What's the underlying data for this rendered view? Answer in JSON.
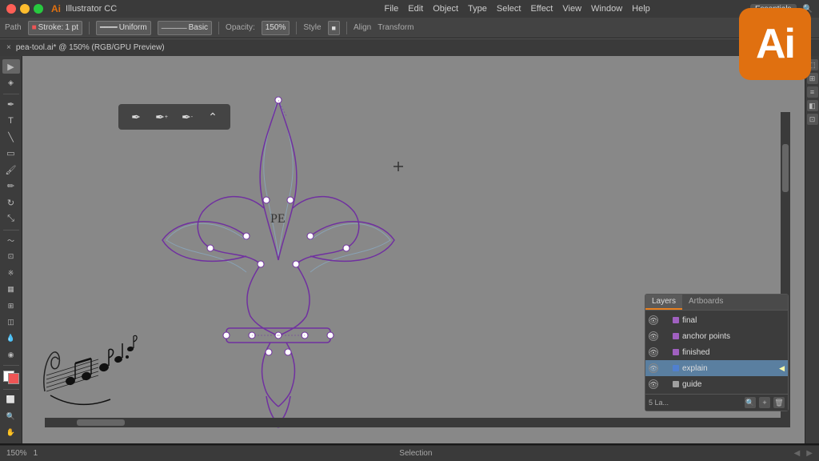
{
  "app": {
    "name": "Illustrator CC",
    "logo_text": "Ai",
    "logo_bg": "#e07010"
  },
  "titlebar": {
    "app_label": "Illustrator CC",
    "menu_items": [
      "File",
      "Edit",
      "Object",
      "Type",
      "Select",
      "Effect",
      "View",
      "Window",
      "Help"
    ],
    "essentials_label": "Essentials",
    "traffic_lights": [
      "red",
      "yellow",
      "green"
    ]
  },
  "toolbar": {
    "path_label": "Path",
    "stroke_label": "Stroke:",
    "stroke_value": "1 pt",
    "uniform_label": "Uniform",
    "basic_label": "Basic",
    "opacity_label": "Opacity:",
    "opacity_value": "150%",
    "style_label": "Style"
  },
  "file_tab": {
    "label": "pea-tool.ai* @ 150% (RGB/GPU Preview)"
  },
  "layers_panel": {
    "tabs": [
      "Layers",
      "Artboards"
    ],
    "active_tab": "Layers",
    "layers": [
      {
        "name": "final",
        "color": "#a060c0",
        "visible": true,
        "locked": false
      },
      {
        "name": "anchor points",
        "color": "#a060c0",
        "visible": true,
        "locked": false
      },
      {
        "name": "finished",
        "color": "#a060c0",
        "visible": true,
        "locked": false
      },
      {
        "name": "explain",
        "color": "#5080d0",
        "visible": true,
        "locked": false,
        "selected": true
      },
      {
        "name": "guide",
        "color": "#a0a0a0",
        "visible": true,
        "locked": false
      }
    ],
    "layer_count": "5 La...",
    "footer_icons": [
      "magnify",
      "new-layer",
      "delete-layer"
    ]
  },
  "status_bar": {
    "zoom_label": "150%",
    "center_label": "Selection",
    "artboard_label": "1"
  },
  "canvas": {
    "pe_label": "PE"
  },
  "pen_palette": {
    "tools": [
      "pen",
      "add-anchor",
      "delete-anchor",
      "convert-anchor"
    ]
  },
  "music_notes": {
    "present": true
  }
}
